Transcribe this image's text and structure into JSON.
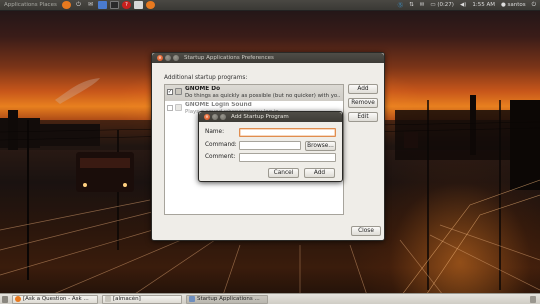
{
  "top_panel": {
    "app_title": "Applications Places",
    "launchers": [
      {
        "icon": "firefox-icon",
        "color": "#e8791f"
      },
      {
        "icon": "power-icon",
        "color": "#d6d6d6"
      },
      {
        "icon": "email-icon",
        "color": "#d6d6d6"
      },
      {
        "icon": "bookmark-icon",
        "color": "#4a7bd0"
      },
      {
        "icon": "terminal-icon",
        "color": "#2a2a2a"
      },
      {
        "icon": "help-icon",
        "color": "#c8201e"
      },
      {
        "icon": "text-editor-icon",
        "color": "#d8d8d8"
      },
      {
        "icon": "firefox-icon",
        "color": "#e8791f"
      }
    ],
    "tray": {
      "battery": "(0:27)",
      "time": "1:55 AM",
      "user": "santos"
    }
  },
  "prefs_window": {
    "title": "Startup Applications Preferences",
    "section_label": "Additional startup programs:",
    "items": [
      {
        "name": "GNOME Do",
        "description": "Do things as quickly as possible (but no quicker) with yo...",
        "checked": true,
        "selected": true
      },
      {
        "name": "GNOME Login Sound",
        "description": "Plays a sound whenever you log in",
        "checked": false,
        "selected": false
      }
    ],
    "buttons": {
      "add": "Add",
      "remove": "Remove",
      "edit": "Edit",
      "close": "Close"
    }
  },
  "add_dialog": {
    "title": "Add Startup Program",
    "name_label": "Name:",
    "name_value": "",
    "command_label": "Command:",
    "command_value": "",
    "comment_label": "Comment:",
    "comment_value": "",
    "browse": "Browse...",
    "cancel": "Cancel",
    "add": "Add"
  },
  "taskbar": {
    "tasks": [
      {
        "label": "[Ask a Question - Ask ...",
        "icon_color": "#e8791f"
      },
      {
        "label": "[almacén]",
        "icon_color": "#c9c6bd"
      },
      {
        "label": "Startup Applications ...",
        "icon_color": "#6f8fbf",
        "active": true
      }
    ]
  }
}
